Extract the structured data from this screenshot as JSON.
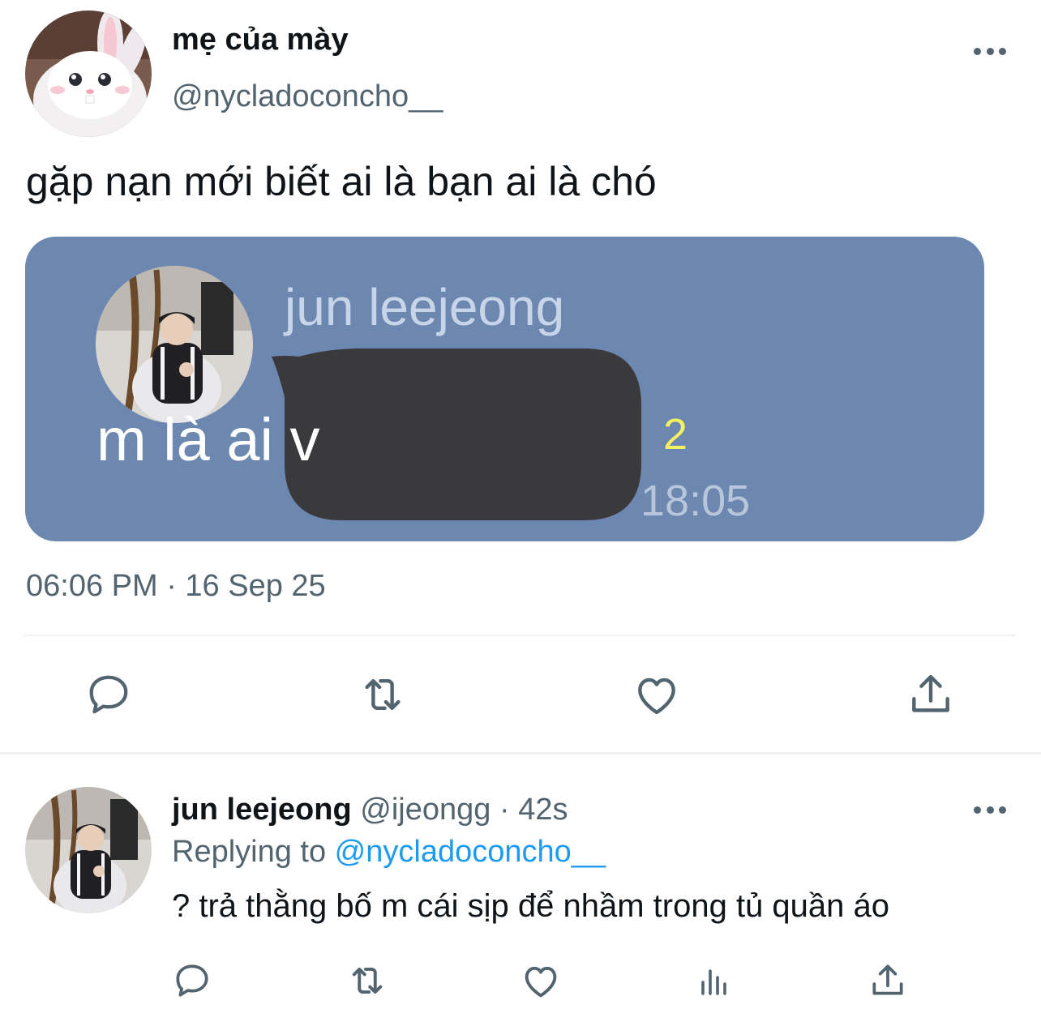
{
  "tweet": {
    "author_name": "mẹ của mày",
    "author_handle": "@nycladoconcho__",
    "text": "gặp nạn mới biết ai là bạn ai là chó",
    "timestamp": "06:06 PM · 16 Sep 25",
    "avatar_icon": "white-rabbit-avatar",
    "media": {
      "chat_name": "jun leejeong",
      "message": "m là ai v",
      "unread_count": "2",
      "time": "18:05",
      "background_color": "#6c87b0",
      "bubble_color": "#3a3a3c"
    },
    "actions": [
      "reply-icon",
      "retweet-icon",
      "like-icon",
      "share-icon"
    ]
  },
  "reply": {
    "author_name": "jun leejeong",
    "author_handle": "@ijeongg",
    "separator": " · ",
    "age": "42s",
    "replying_prefix": "Replying to ",
    "replying_to": "@nycladoconcho__",
    "text": "? trả thằng bố m cái sịp để nhầm trong tủ quần áo",
    "actions": [
      "reply-icon",
      "retweet-icon",
      "like-icon",
      "views-icon",
      "share-icon"
    ]
  },
  "colors": {
    "text_primary": "#0f1419",
    "text_secondary": "#536471",
    "link": "#1d9bf0",
    "divider": "#eff3f4"
  }
}
